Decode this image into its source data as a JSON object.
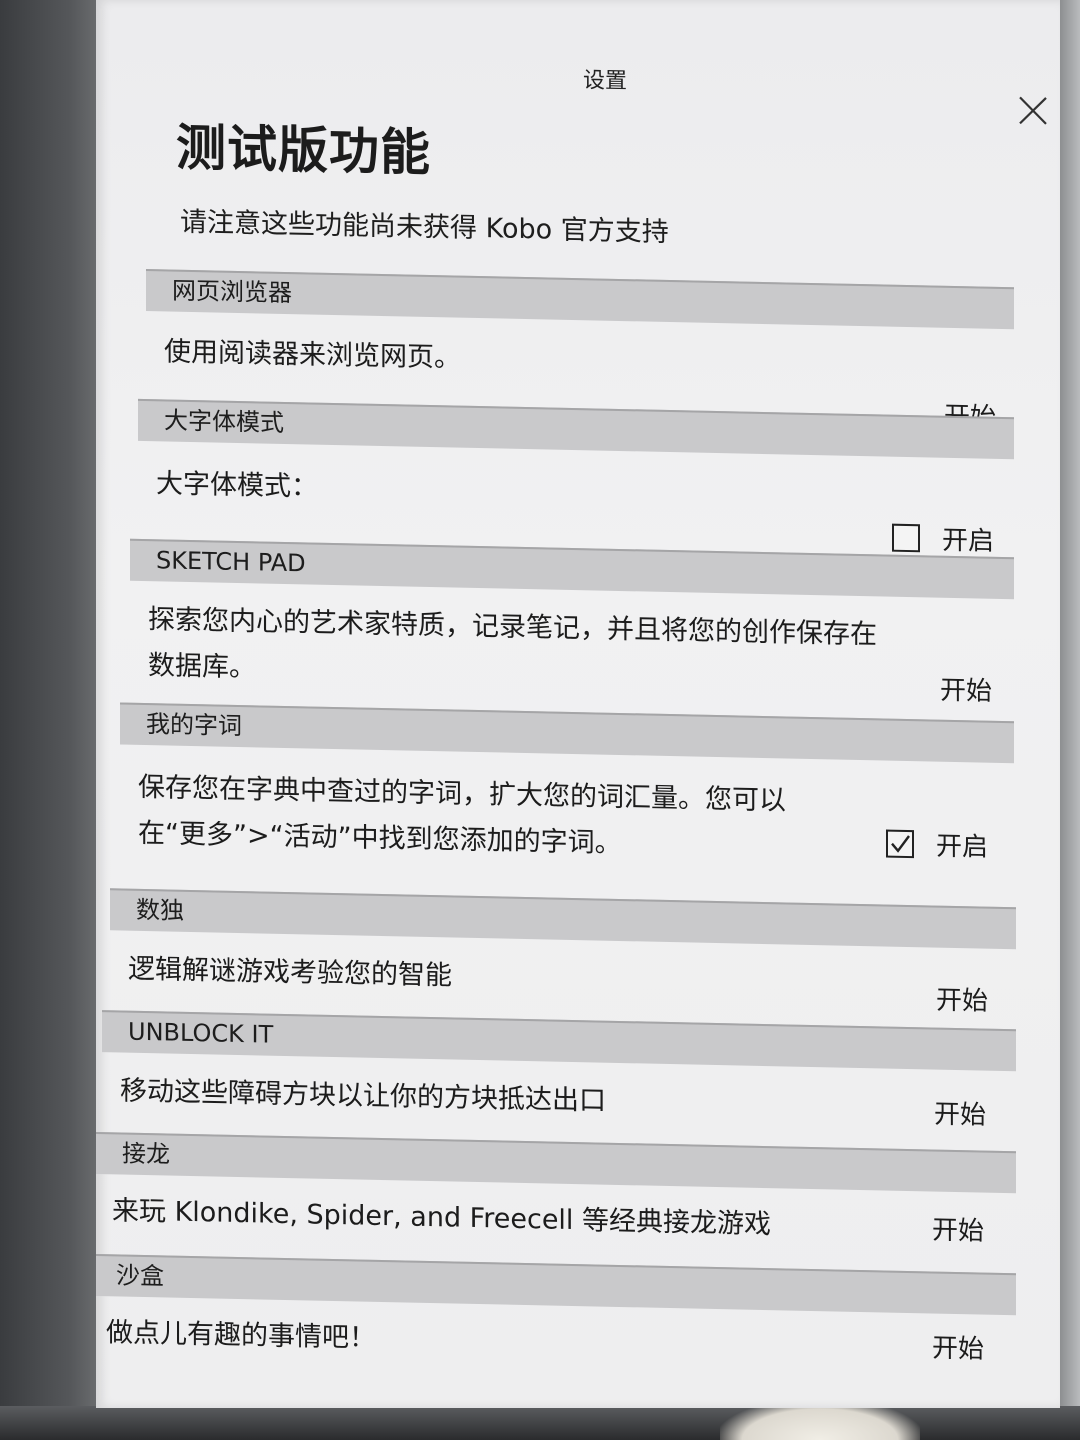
{
  "header": {
    "title": "设置",
    "close_icon": "close-icon"
  },
  "page": {
    "title": "测试版功能",
    "subtitle": "请注意这些功能尚未获得 Kobo 官方支持"
  },
  "sections": [
    {
      "header": "网页浏览器",
      "description": "使用阅读器来浏览网页。",
      "action_label": "开始",
      "type": "button"
    },
    {
      "header": "大字体模式",
      "description": "大字体模式：",
      "action_label": "开启",
      "type": "checkbox",
      "checked": false
    },
    {
      "header": "SKETCH PAD",
      "description": "探索您内心的艺术家特质，记录笔记，并且将您的创作保存在数据库。",
      "action_label": "开始",
      "type": "button"
    },
    {
      "header": "我的字词",
      "description": "保存您在字典中查过的字词，扩大您的词汇量。您可以在“更多”>“活动”中找到您添加的字词。",
      "action_label": "开启",
      "type": "checkbox",
      "checked": true
    },
    {
      "header": "数独",
      "description": "逻辑解谜游戏考验您的智能",
      "action_label": "开始",
      "type": "button"
    },
    {
      "header": "UNBLOCK IT",
      "description": "移动这些障碍方块以让你的方块抵达出口",
      "action_label": "开始",
      "type": "button"
    },
    {
      "header": "接龙",
      "description": "来玩 Klondike, Spider, and Freecell 等经典接龙游戏",
      "action_label": "开始",
      "type": "button"
    },
    {
      "header": "沙盒",
      "description": "做点儿有趣的事情吧！",
      "action_label": "开始",
      "type": "button"
    }
  ]
}
